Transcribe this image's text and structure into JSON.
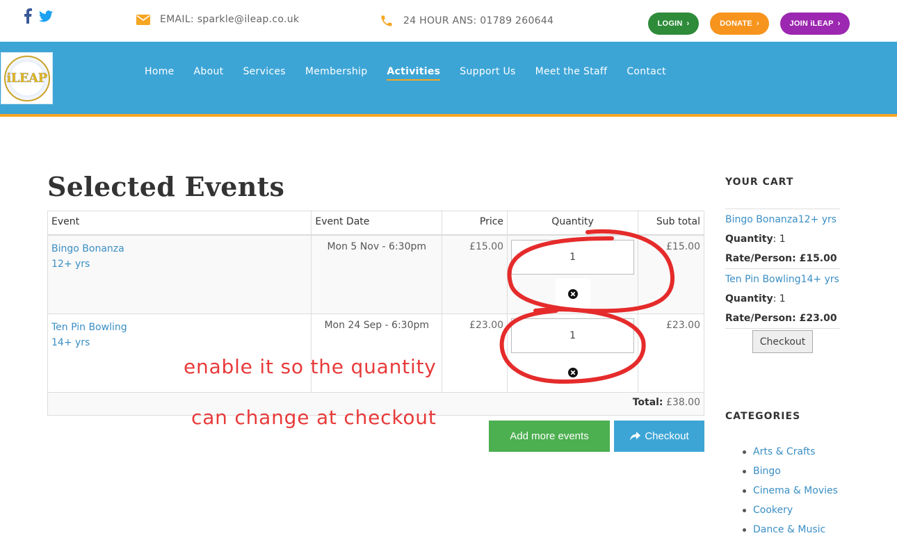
{
  "topbar": {
    "email_label": "EMAIL: sparkle@ileap.co.uk",
    "phone_label": "24 HOUR ANS: 01789 260644",
    "buttons": {
      "login": "LOGIN",
      "donate": "DONATE",
      "join": "JOIN iLEAP"
    },
    "colors": {
      "login": "#2e8b3a",
      "donate": "#f7941d",
      "join": "#9c27b0",
      "icon": "#f5a623"
    }
  },
  "logo": {
    "text": "iLEAP"
  },
  "nav": {
    "items": [
      "Home",
      "About",
      "Services",
      "Membership",
      "Activities",
      "Support Us",
      "Meet the Staff",
      "Contact"
    ],
    "active": "Activities",
    "color": "#3da5d6"
  },
  "main": {
    "title": "Selected Events",
    "table": {
      "headers": [
        "Event",
        "Event Date",
        "Price",
        "Quantity",
        "Sub total"
      ],
      "rows": [
        {
          "event": "Bingo Bonanza",
          "age": "12+ yrs",
          "date": "Mon 5 Nov - 6:30pm",
          "price": "£15.00",
          "quantity": "1",
          "subtotal": "£15.00"
        },
        {
          "event": "Ten Pin Bowling",
          "age": "14+ yrs",
          "date": "Mon 24 Sep - 6:30pm",
          "price": "£23.00",
          "quantity": "1",
          "subtotal": "£23.00"
        }
      ],
      "total_label": "Total:",
      "total_value": "£38.00"
    },
    "buttons": {
      "add_more": "Add more events",
      "checkout": "Checkout"
    },
    "annotations": [
      "enable it so the quantity",
      "can change at checkout"
    ]
  },
  "sidebar": {
    "cart_heading": "YOUR CART",
    "cart_items": [
      {
        "name": "Bingo Bonanza12+ yrs",
        "quantity_label": "Quantity",
        "quantity": ": 1",
        "rate_label": "Rate/Person",
        "rate": ": £15.00"
      },
      {
        "name": "Ten Pin Bowling14+ yrs",
        "quantity_label": "Quantity",
        "quantity": ": 1",
        "rate_label": "Rate/Person",
        "rate": ": £23.00"
      }
    ],
    "cart_checkout": "Checkout",
    "categories_heading": "CATEGORIES",
    "categories": [
      "Arts & Crafts",
      "Bingo",
      "Cinema & Movies",
      "Cookery",
      "Dance & Music"
    ]
  }
}
